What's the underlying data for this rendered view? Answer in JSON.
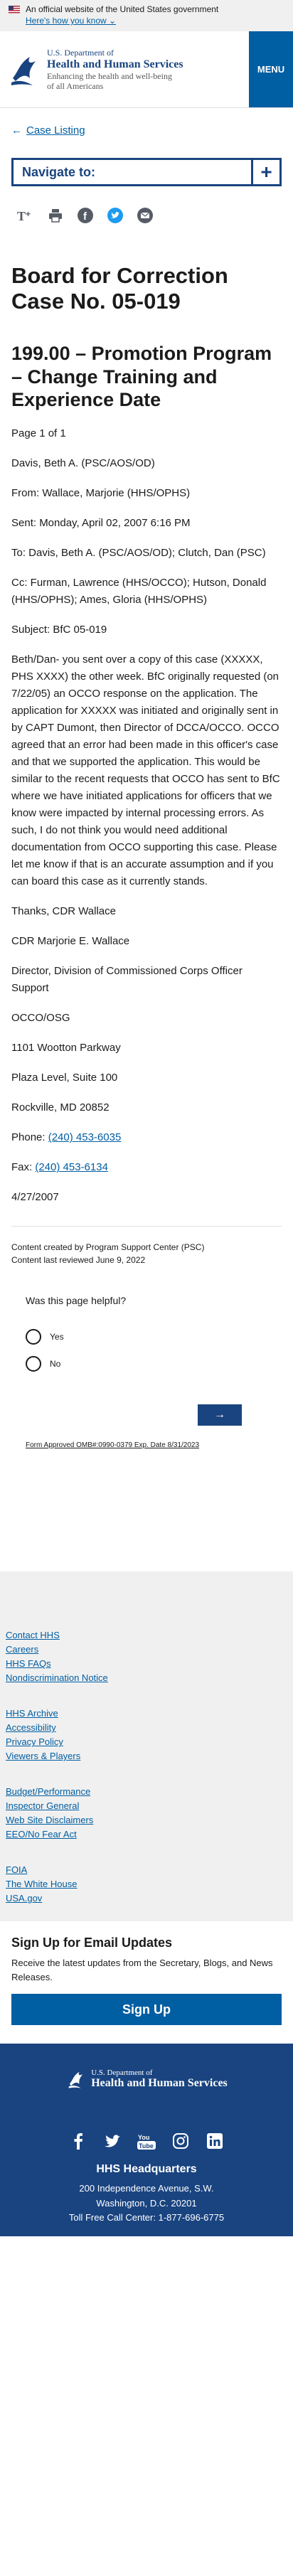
{
  "gov_banner": {
    "official_text": "An official website of the United States government",
    "how_link": "Here's how you know"
  },
  "header": {
    "logo_line1": "U.S. Department of",
    "logo_line2": "Health and Human Services",
    "logo_line3": "Enhancing the health and well-being",
    "logo_line4": "of all Americans",
    "menu_label": "MENU"
  },
  "breadcrumb": {
    "back_label": "Case Listing"
  },
  "navigate": {
    "label": "Navigate to:"
  },
  "page": {
    "title": "Board for Correction Case No. 05-019",
    "subtitle": "199.00 – Promotion Program – Change Training and Experience Date",
    "paragraphs": [
      "Page 1 of 1",
      "Davis, Beth A. (PSC/AOS/OD)",
      "From: Wallace, Marjorie (HHS/OPHS)",
      "Sent: Monday, April 02, 2007 6:16 PM",
      "To: Davis, Beth A. (PSC/AOS/OD); Clutch, Dan (PSC)",
      "Cc: Furman, Lawrence (HHS/OCCO); Hutson, Donald (HHS/OPHS); Ames, Gloria (HHS/OPHS)",
      "Subject: BfC 05-019",
      "Beth/Dan- you sent over a copy of this case (XXXXX, PHS XXXX) the other week. BfC originally requested (on 7/22/05) an OCCO response on the application. The application for XXXXX was initiated and originally sent in by CAPT Dumont, then Director of DCCA/OCCO. OCCO agreed that an error had been made in this officer's case and that we supported the application. This would be similar to the recent requests that OCCO has sent to BfC where we have initiated applications for officers that we know were impacted by internal processing errors. As such, I do not think you would need additional documentation from OCCO supporting this case. Please let me know if that is an accurate assumption and if you can board this case as it currently stands.",
      "Thanks, CDR Wallace",
      "CDR Marjorie E. Wallace",
      "Director, Division of Commissioned Corps Officer Support",
      "OCCO/OSG",
      "1101 Wootton Parkway",
      "Plaza Level, Suite 100",
      "Rockville, MD 20852"
    ],
    "phone_label": "Phone: ",
    "phone": "(240) 453-6035",
    "fax_label": "Fax: ",
    "fax": "(240) 453-6134",
    "date": "4/27/2007",
    "created_by": "Content created by Program Support Center (PSC)",
    "last_reviewed": "Content last reviewed June 9, 2022"
  },
  "feedback": {
    "question": "Was this page helpful?",
    "yes": "Yes",
    "no": "No",
    "submit_glyph": "→",
    "omb": "Form Approved OMB#:0990-0379 Exp. Date 8/31/2023"
  },
  "footer_links": {
    "group1": [
      "Contact HHS",
      "Careers",
      "HHS FAQs",
      "Nondiscrimination Notice"
    ],
    "group2": [
      "HHS Archive",
      "Accessibility",
      "Privacy Policy",
      "Viewers & Players"
    ],
    "group3": [
      "Budget/Performance",
      "Inspector General",
      "Web Site Disclaimers",
      "EEO/No Fear Act"
    ],
    "group4": [
      "FOIA",
      "The White House",
      "USA.gov"
    ]
  },
  "signup": {
    "heading": "Sign Up for Email Updates",
    "text": "Receive the latest updates from the Secretary, Blogs, and News Releases.",
    "button": "Sign Up"
  },
  "bottom_footer": {
    "logo_line1": "U.S. Department of",
    "logo_line2": "Health and Human Services",
    "hq_title": "HHS Headquarters",
    "address1": "200 Independence Avenue, S.W.",
    "address2": "Washington, D.C. 20201",
    "tollfree": "Toll Free Call Center: 1-877-696-6775",
    "social_icons": [
      "facebook-icon",
      "twitter-icon",
      "youtube-icon",
      "instagram-icon",
      "linkedin-icon"
    ]
  },
  "colors": {
    "primary": "#005ea2",
    "dark": "#1a4480",
    "footer_bg": "#f0f0f0"
  }
}
